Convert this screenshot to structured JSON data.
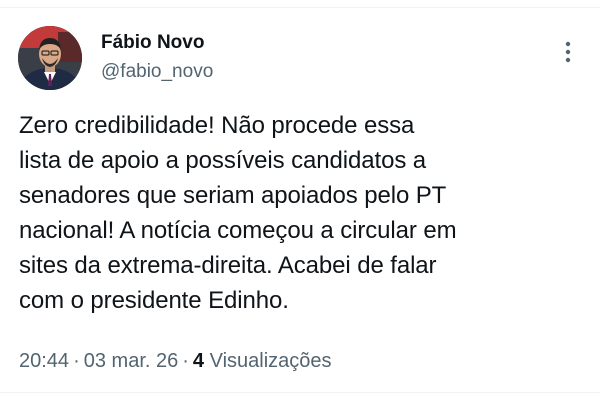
{
  "author": {
    "display_name": "Fábio Novo",
    "handle": "@fabio_novo"
  },
  "tweet": {
    "text": "Zero credibilidade! Não procede essa\nlista de apoio a possíveis candidatos a\nsenadores que seriam apoiados pelo PT\nnacional! A notícia começou a circular em\nsites da extrema-direita. Acabei de falar\ncom o presidente Edinho."
  },
  "meta": {
    "time": "20:44",
    "date": "03 mar. 26",
    "separator": "·",
    "views_count": "4",
    "views_label": "Visualizações"
  },
  "icons": {
    "more": "more-vertical-icon",
    "avatar": "profile-photo"
  },
  "colors": {
    "text_primary": "#0f1419",
    "text_secondary": "#536471",
    "divider": "#eff3f4"
  }
}
